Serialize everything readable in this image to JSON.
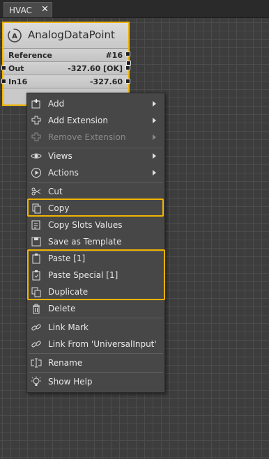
{
  "tab": {
    "label": "HVAC",
    "close": "✕"
  },
  "node": {
    "title": "AnalogDataPoint",
    "icon": "analog-point-icon",
    "slots": [
      {
        "name": "Reference",
        "value": "#16"
      },
      {
        "name": "Out",
        "value": "-327.60 [OK]"
      },
      {
        "name": "In16",
        "value": "-327.60"
      }
    ]
  },
  "menu": {
    "items": [
      {
        "label": "Add",
        "icon": "add-icon",
        "submenu": true,
        "disabled": false
      },
      {
        "label": "Add Extension",
        "icon": "add-extension-icon",
        "submenu": true,
        "disabled": false
      },
      {
        "label": "Remove Extension",
        "icon": "remove-extension-icon",
        "submenu": true,
        "disabled": true
      },
      {
        "label": "Views",
        "icon": "eye-icon",
        "submenu": true,
        "disabled": false
      },
      {
        "label": "Actions",
        "icon": "play-icon",
        "submenu": true,
        "disabled": false
      },
      {
        "label": "Cut",
        "icon": "scissors-icon",
        "submenu": false,
        "disabled": false
      },
      {
        "label": "Copy",
        "icon": "copy-icon",
        "submenu": false,
        "disabled": false
      },
      {
        "label": "Copy Slots Values",
        "icon": "copy-slots-icon",
        "submenu": false,
        "disabled": false
      },
      {
        "label": "Save as Template",
        "icon": "template-icon",
        "submenu": false,
        "disabled": false
      },
      {
        "label": "Paste [1]",
        "icon": "paste-icon",
        "submenu": false,
        "disabled": false
      },
      {
        "label": "Paste Special [1]",
        "icon": "paste-special-icon",
        "submenu": false,
        "disabled": false
      },
      {
        "label": "Duplicate",
        "icon": "duplicate-icon",
        "submenu": false,
        "disabled": false
      },
      {
        "label": "Delete",
        "icon": "trash-icon",
        "submenu": false,
        "disabled": false
      },
      {
        "label": "Link Mark",
        "icon": "link-icon",
        "submenu": false,
        "disabled": false
      },
      {
        "label": "Link From 'UniversalInput'",
        "icon": "link-from-icon",
        "submenu": false,
        "disabled": false
      },
      {
        "label": "Rename",
        "icon": "rename-icon",
        "submenu": false,
        "disabled": false
      },
      {
        "label": "Show Help",
        "icon": "help-bulb-icon",
        "submenu": false,
        "disabled": false
      }
    ]
  },
  "colors": {
    "highlight": "#f0b400",
    "menu_bg": "#474747",
    "canvas_bg": "#3d3d3d",
    "node_bg": "#c9c9c9"
  }
}
